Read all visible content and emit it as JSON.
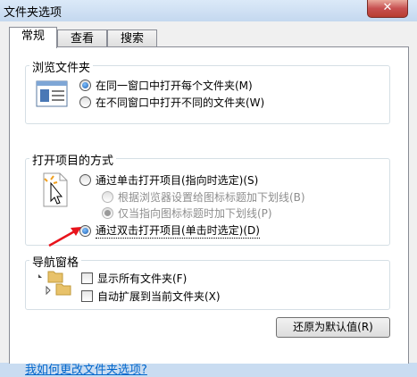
{
  "window": {
    "title": "文件夹选项",
    "close_glyph": "✕"
  },
  "tabs": [
    {
      "label": "常规",
      "active": true
    },
    {
      "label": "查看",
      "active": false
    },
    {
      "label": "搜索",
      "active": false
    }
  ],
  "browse_folders": {
    "label": "浏览文件夹",
    "options": [
      {
        "label": "在同一窗口中打开每个文件夹(M)",
        "checked": true
      },
      {
        "label": "在不同窗口中打开不同的文件夹(W)",
        "checked": false
      }
    ]
  },
  "open_items": {
    "label": "打开项目的方式",
    "options": [
      {
        "label": "通过单击打开项目(指向时选定)(S)",
        "checked": false
      },
      {
        "label": "根据浏览器设置给图标标题加下划线(B)",
        "checked": false,
        "disabled": true
      },
      {
        "label": "仅当指向图标标题时加下划线(P)",
        "checked": true,
        "disabled": true
      },
      {
        "label": "通过双击打开项目(单击时选定)(D)",
        "checked": true
      }
    ]
  },
  "nav_pane": {
    "label": "导航窗格",
    "options": [
      {
        "label": "显示所有文件夹(F)",
        "checked": false
      },
      {
        "label": "自动扩展到当前文件夹(X)",
        "checked": false
      }
    ]
  },
  "restore_defaults": "还原为默认值(R)",
  "help_link": "我如何更改文件夹选项?",
  "colors": {
    "annotation_arrow": "#e8141c",
    "link": "#0066cc"
  }
}
